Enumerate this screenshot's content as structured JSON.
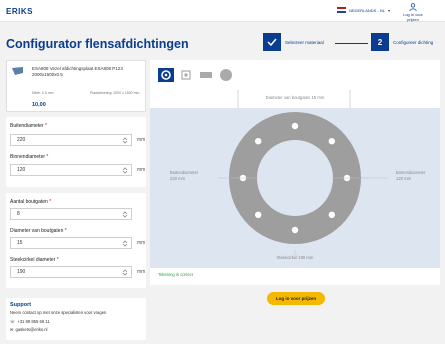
{
  "header": {
    "logo": "ERIKS",
    "language": "NEDERLANDS - NL",
    "login": "Log in voor prijzen"
  },
  "page": {
    "title": "Configurator flensafdichtingen"
  },
  "steps": [
    {
      "label": "Selecteer materiaal",
      "status": "done"
    },
    {
      "number": "2",
      "label": "Configureer dichting",
      "status": "active"
    }
  ],
  "product": {
    "name": "ESA808 Vezel afdichtingsplaat ESA808 P123 2000x1500x0.5",
    "meta1": "Dikte: 0.5 mm",
    "meta2": "Plaatafmeting: 2000 x 1500 mm",
    "price": "10,00"
  },
  "form": {
    "outer_label": "Buitendiameter",
    "outer_value": "220",
    "inner_label": "Binnendiameter",
    "inner_value": "120",
    "holes_label": "Aantal boutgaten",
    "holes_value": "8",
    "hole_diam_label": "Diameter van boutgaten",
    "hole_diam_value": "15",
    "pitch_label": "Steekcirkel diameter",
    "pitch_value": "190",
    "unit": "mm",
    "required_mark": "*"
  },
  "support": {
    "title": "Support",
    "text": "Neem contact op met onze specialisten voor vragen",
    "phone": "+31 88 855 66 11",
    "email": "gaskets@eriks.nl"
  },
  "canvas": {
    "shapes": [
      "ring-shape-icon",
      "square-shape-icon",
      "rect-shape-icon",
      "circle-shape-icon"
    ],
    "dim_top": "Diameter van boutgaten 15 mm",
    "dim_left_label": "Buitendiameter",
    "dim_left_value": "220 mm",
    "dim_right_label": "Binnendiameter",
    "dim_right_value": "120 mm",
    "dim_bottom": "Steekcirkel 190 mm",
    "valid": "Tekening is correct",
    "holes": 8,
    "colors": {
      "ring": "#9e9e9e",
      "background": "#dde6f0",
      "accent": "#0a3d8f"
    }
  },
  "cta": {
    "label": "Log in voor prijzen"
  }
}
